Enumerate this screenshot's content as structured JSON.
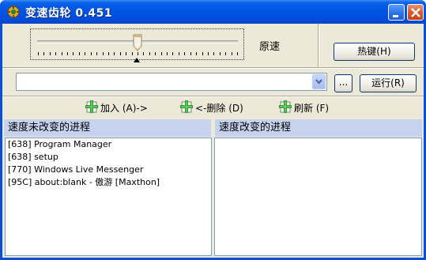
{
  "window": {
    "title": "变速齿轮 0.451",
    "icon": "gear-app-icon",
    "controls": [
      "minimize-icon",
      "close-icon"
    ]
  },
  "speed": {
    "label": "原速",
    "slider_fraction": 0.5,
    "tick_count": 35
  },
  "buttons": {
    "hotkey_label": "热键(H)",
    "browse_label": "...",
    "run_label": "运行(R)"
  },
  "combo": {
    "value": ""
  },
  "actions": [
    {
      "label": "加入 (A)->",
      "icon": "add-icon"
    },
    {
      "label": "<-删除 (D)",
      "icon": "add-icon"
    },
    {
      "label": "刷新 (F)",
      "icon": "add-icon"
    }
  ],
  "panels": {
    "unchanged_title": "速度未改变的进程",
    "changed_title": "速度改变的进程",
    "unchanged_items": [
      "[638]  Program Manager",
      "[638]  setup",
      "[770]  Windows Live Messenger",
      "[95C]  about:blank - 傲游 [Maxthon]"
    ],
    "changed_items": []
  },
  "colors": {
    "titlebar": "#0054e3",
    "panel_header": "#c6d2ee",
    "face": "#ece9d8",
    "icon_green": "#2e9d2e"
  }
}
